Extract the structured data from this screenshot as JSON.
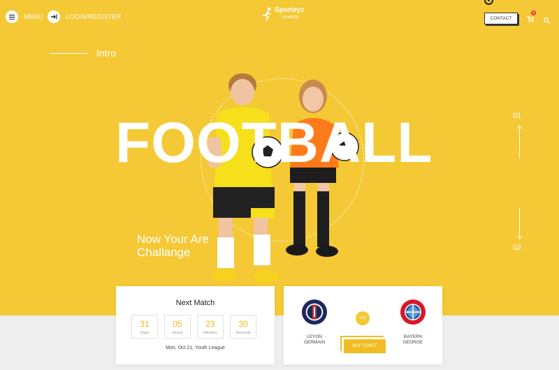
{
  "header": {
    "menu_label": "MENU",
    "login_label": "LOGIN/REGISTER",
    "logo_name": "Sporteyz",
    "logo_sub": "Academy",
    "contact_label": "CONTACT",
    "cart_count": "0",
    "menu_icon": "hamburger-icon",
    "login_icon": "login-icon",
    "cart_icon": "cart-icon",
    "search_icon": "search-icon"
  },
  "hero": {
    "intro": "Intro",
    "title": "FOOTBALL",
    "tagline_line1": "Now Your Are",
    "tagline_line2": "Challange",
    "slide_top": "01",
    "slide_bottom": "02"
  },
  "next_match": {
    "title": "Next Match",
    "countdown": [
      {
        "value": "31",
        "label": "Days"
      },
      {
        "value": "05",
        "label": "Hours"
      },
      {
        "value": "23",
        "label": "Minutes"
      },
      {
        "value": "30",
        "label": "Seconds"
      }
    ],
    "date": "Mon, Oct 21, Youth League"
  },
  "fixture": {
    "home_line1": "LEYON",
    "home_line2": "GERMAIN",
    "vs": "VS",
    "away_line1": "BAYERN",
    "away_line2": "GEORGE",
    "buy_label": "BUY TICKET"
  },
  "colors": {
    "accent": "#f4c935",
    "accent_dark": "#f2b51c",
    "band": "#eeeeee"
  }
}
